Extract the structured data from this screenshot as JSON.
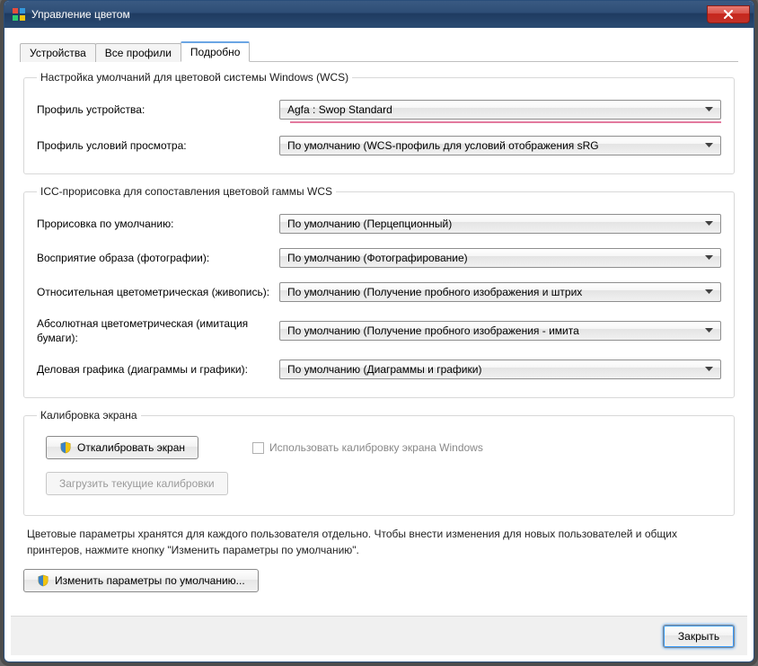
{
  "window": {
    "title": "Управление цветом"
  },
  "tabs": {
    "devices": "Устройства",
    "all_profiles": "Все профили",
    "advanced": "Подробно"
  },
  "group_defaults": {
    "legend": "Настройка умолчаний для цветовой системы Windows (WCS)",
    "device_profile_label": "Профиль устройства:",
    "device_profile_value": "Agfa : Swop Standard",
    "viewing_profile_label": "Профиль условий просмотра:",
    "viewing_profile_value": "По умолчанию (WCS-профиль для условий отображения sRG"
  },
  "group_icc": {
    "legend": "ICC-прорисовка для сопоставления цветовой гаммы WCS",
    "default_rendering_label": "Прорисовка по умолчанию:",
    "default_rendering_value": "По умолчанию (Перцепционный)",
    "perceptual_label": "Восприятие образа (фотографии):",
    "perceptual_value": "По умолчанию (Фотографирование)",
    "rel_colorimetric_label": "Относительная цветометрическая (живопись):",
    "rel_colorimetric_value": "По умолчанию (Получение пробного изображения и штрих",
    "abs_colorimetric_label": "Абсолютная цветометрическая (имитация бумаги):",
    "abs_colorimetric_value": "По умолчанию (Получение пробного изображения - имита",
    "business_label": "Деловая графика (диаграммы и графики):",
    "business_value": "По умолчанию (Диаграммы и графики)"
  },
  "group_calibration": {
    "legend": "Калибровка экрана",
    "calibrate_button": "Откалибровать экран",
    "load_button": "Загрузить текущие калибровки",
    "use_windows_cal": "Использовать калибровку экрана Windows"
  },
  "note_text": "Цветовые параметры хранятся для каждого пользователя отдельно. Чтобы внести изменения для новых пользователей и общих принтеров, нажмите кнопку \"Изменить параметры по умолчанию\".",
  "change_defaults_button": "Изменить параметры по умолчанию...",
  "close_button": "Закрыть"
}
